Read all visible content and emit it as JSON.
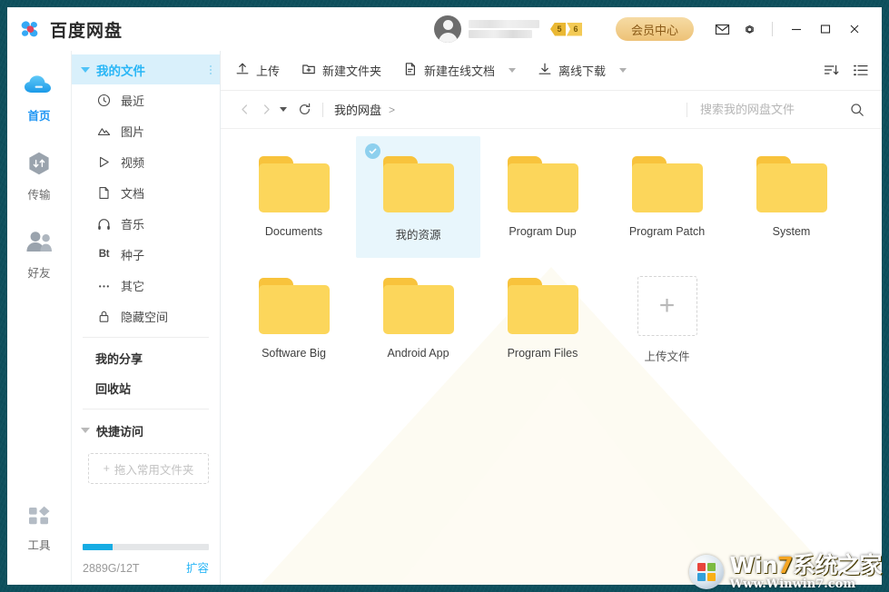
{
  "app": {
    "brand_name": "百度网盘",
    "logo_icon": "baidu-cloud-logo"
  },
  "titlebar": {
    "avatar_icon": "user-avatar",
    "username_redacted": "",
    "badges": [
      "5",
      "6"
    ],
    "vip_button": "会员中心",
    "mail_icon": "mail-icon",
    "settings_icon": "gear-icon",
    "minimize_icon": "minimize-icon",
    "maximize_icon": "maximize-icon",
    "close_icon": "close-icon"
  },
  "rail": {
    "items": [
      {
        "label": "首页",
        "icon": "cloud-icon",
        "active": true
      },
      {
        "label": "传输",
        "icon": "transfer-hexagon-icon",
        "active": false
      },
      {
        "label": "好友",
        "icon": "friends-icon",
        "active": false
      }
    ],
    "bottom": {
      "label": "工具",
      "icon": "tools-grid-icon"
    }
  },
  "tree": {
    "header": {
      "label": "我的文件",
      "menu_icon": "kebab-menu-icon"
    },
    "items": [
      {
        "label": "最近",
        "icon": "clock-icon"
      },
      {
        "label": "图片",
        "icon": "image-icon"
      },
      {
        "label": "视频",
        "icon": "video-play-icon"
      },
      {
        "label": "文档",
        "icon": "document-icon"
      },
      {
        "label": "音乐",
        "icon": "headphones-icon"
      },
      {
        "label": "种子",
        "icon": "bt-icon",
        "icon_text": "Bt"
      },
      {
        "label": "其它",
        "icon": "ellipsis-icon"
      },
      {
        "label": "隐藏空间",
        "icon": "lock-icon"
      }
    ],
    "links": [
      {
        "label": "我的分享"
      },
      {
        "label": "回收站"
      }
    ],
    "quick_access": {
      "label": "快捷访问"
    },
    "dropzone": {
      "label": "拖入常用文件夹",
      "plus": "+"
    },
    "storage": {
      "used_label": "2889G/12T",
      "expand_label": "扩容",
      "percent": 24,
      "bar_color": "#16ace3"
    }
  },
  "toolbar": {
    "buttons": [
      {
        "label": "上传",
        "icon": "upload-icon",
        "dropdown": false
      },
      {
        "label": "新建文件夹",
        "icon": "new-folder-icon",
        "dropdown": false
      },
      {
        "label": "新建在线文档",
        "icon": "new-doc-icon",
        "dropdown": true
      },
      {
        "label": "离线下载",
        "icon": "offline-download-icon",
        "dropdown": true
      }
    ],
    "sort_icon": "sort-descending-icon",
    "view_icon": "list-view-icon"
  },
  "navbar": {
    "back_icon": "chevron-left-icon",
    "forward_icon": "chevron-right-icon",
    "history_caret_icon": "chevron-down-icon",
    "refresh_icon": "refresh-icon",
    "breadcrumb": [
      "我的网盘"
    ],
    "breadcrumb_sep": ">"
  },
  "search": {
    "placeholder": "搜索我的网盘文件",
    "search_icon": "search-icon"
  },
  "files": {
    "items": [
      {
        "name": "Documents",
        "type": "folder",
        "selected": false
      },
      {
        "name": "我的资源",
        "type": "folder",
        "selected": true
      },
      {
        "name": "Program Dup",
        "type": "folder",
        "selected": false
      },
      {
        "name": "Program Patch",
        "type": "folder",
        "selected": false
      },
      {
        "name": "System",
        "type": "folder",
        "selected": false
      },
      {
        "name": "Software Big",
        "type": "folder",
        "selected": false
      },
      {
        "name": "Android App",
        "type": "folder",
        "selected": false
      },
      {
        "name": "Program Files",
        "type": "folder",
        "selected": false
      }
    ],
    "upload_tile": {
      "label": "上传文件",
      "plus": "+",
      "icon": "plus-icon"
    },
    "folder_color": "#fcd65b",
    "folder_tab_color": "#f8c33c",
    "selected_bg": "#e8f6fc",
    "check_color": "#8ed0ee"
  },
  "watermark": {
    "main_prefix": "Win",
    "main_highlight": "7",
    "main_suffix": "系统之家",
    "sub": "Www.Winwin7.com",
    "logo_icon": "windows-logo-icon"
  }
}
